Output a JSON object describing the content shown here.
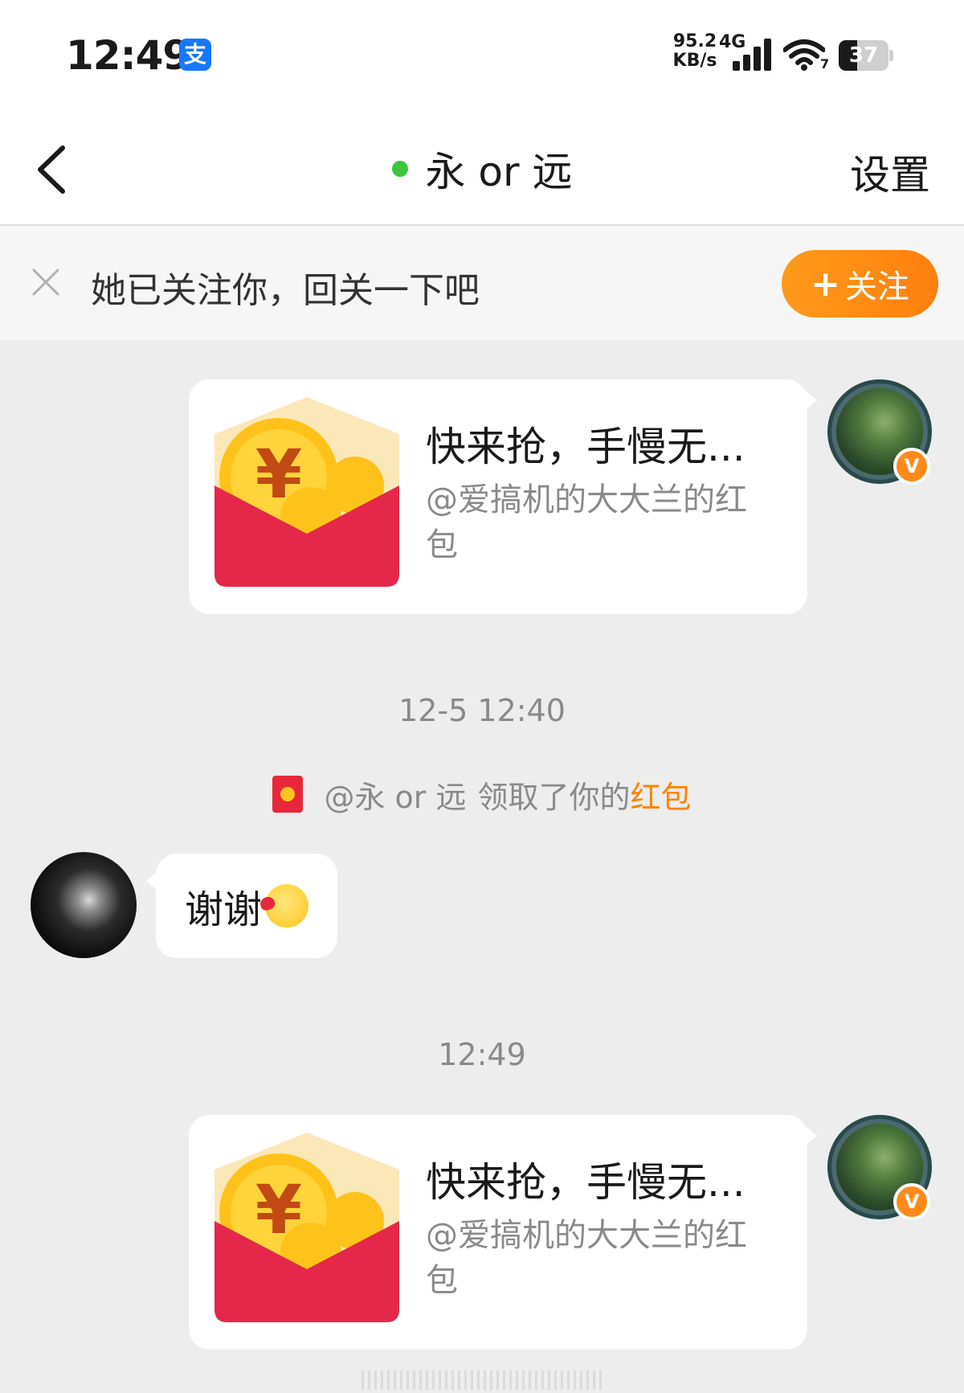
{
  "status_bar": {
    "time": "12:49",
    "alipay_icon_text": "支",
    "net_speed_value": "95.2",
    "net_speed_unit": "KB/s",
    "net_type": "4G",
    "wifi_badge": "7",
    "battery_level": "37",
    "battery_fraction": 0.37
  },
  "header": {
    "title": "永 or 远",
    "settings": "设置"
  },
  "follow_banner": {
    "text": "她已关注你，回关一下吧",
    "button_plus": "+",
    "button_label": "关注"
  },
  "messages": {
    "red_packet_1": {
      "title": "快来抢，手慢无...",
      "subtitle": "@爱搞机的大大兰的红包"
    },
    "timestamp_1": "12-5 12:40",
    "notice": {
      "user": "@永 or 远",
      "action": "领取了你的",
      "link": "红包"
    },
    "text_message": {
      "text": "谢谢"
    },
    "timestamp_2": "12:49",
    "red_packet_2": {
      "title": "快来抢，手慢无...",
      "subtitle": "@爱搞机的大大兰的红包"
    },
    "verify_badge": "V"
  },
  "icons": {
    "back": "chevron-left-icon",
    "close": "close-icon",
    "signal": "signal-icon",
    "wifi": "wifi-icon",
    "emoji": "kiss-emoji-icon"
  },
  "colors": {
    "accent_orange": "#ff8200",
    "online_green": "#3cc43c",
    "red_packet": "#e8283a",
    "alipay_blue": "#1677ff"
  }
}
